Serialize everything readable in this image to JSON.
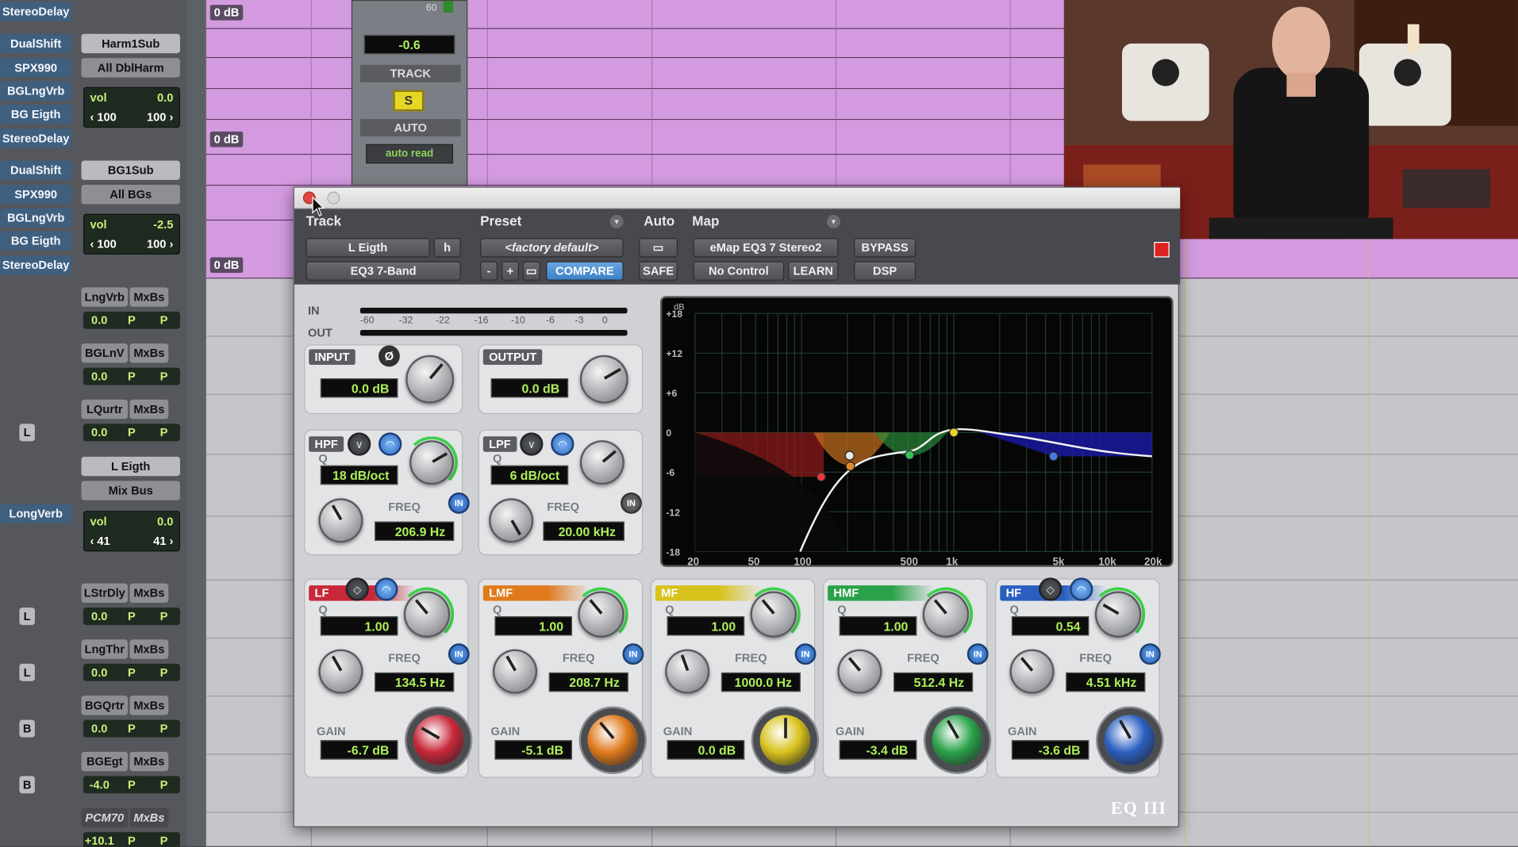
{
  "mixer": {
    "rows_top": [
      {
        "sends": [
          "StereoDelay"
        ]
      },
      {
        "a": "DualShift",
        "b": "SPX990",
        "c": "BGLngVrb",
        "d": "BG Eigth",
        "e": "StereoDelay",
        "insert": "Harm1Sub",
        "group": "All DblHarm",
        "vol_label": "vol",
        "vol_val": "0.0",
        "pan_l": "‹ 100",
        "pan_r": "100 ›"
      },
      {
        "a": "DualShift",
        "b": "SPX990",
        "c": "BGLngVrb",
        "d": "BG Eigth",
        "e": "StereoDelay",
        "insert": "BG1Sub",
        "group": "All BGs",
        "vol_label": "vol",
        "vol_val": "-2.5",
        "pan_l": "‹ 100",
        "pan_r": "100 ›"
      }
    ],
    "bus_rows": [
      {
        "name": "LngVrb",
        "bus": "MxBs",
        "val": "0.0",
        "p1": "P",
        "p2": "P",
        "letter": ""
      },
      {
        "name": "BGLnV",
        "bus": "MxBs",
        "val": "0.0",
        "p1": "P",
        "p2": "P",
        "letter": ""
      },
      {
        "name": "LQurtr",
        "bus": "MxBs",
        "val": "0.0",
        "p1": "P",
        "p2": "P",
        "letter": "L"
      }
    ],
    "leigth": {
      "insert": "L Eigth",
      "output": "Mix Bus",
      "send": "LongVerb",
      "vol_label": "vol",
      "vol_val": "0.0",
      "pan_l": "‹ 41",
      "pan_r": "41 ›"
    },
    "bus_rows2": [
      {
        "name": "LStrDly",
        "bus": "MxBs",
        "val": "0.0",
        "p1": "P",
        "p2": "P",
        "letter": "L"
      },
      {
        "name": "LngThr",
        "bus": "MxBs",
        "val": "0.0",
        "p1": "P",
        "p2": "P",
        "letter": "L"
      },
      {
        "name": "BGQrtr",
        "bus": "MxBs",
        "val": "0.0",
        "p1": "P",
        "p2": "P",
        "letter": "B"
      },
      {
        "name": "BGEgt",
        "bus": "MxBs",
        "val": "-4.0",
        "p1": "P",
        "p2": "P",
        "letter": "B"
      },
      {
        "name": "PCM70",
        "bus": "MxBs",
        "val": "+10.1",
        "p1": "P",
        "p2": "P",
        "letter": ""
      }
    ]
  },
  "timeline": {
    "db_labels": [
      "0 dB",
      "0 dB",
      "0 dB"
    ]
  },
  "track_window": {
    "level_top": "60",
    "value": "-0.6",
    "track_label": "TRACK",
    "solo": "S",
    "auto_label": "AUTO",
    "auto_mode": "auto read"
  },
  "plugin": {
    "header": {
      "track_label": "Track",
      "preset_label": "Preset",
      "auto_label": "Auto",
      "map_label": "Map",
      "track_name": "L Eigth",
      "track_h": "h",
      "preset_name": "<factory default>",
      "insert_name": "EQ3 7-Band",
      "minus": "-",
      "plus": "+",
      "compare": "COMPARE",
      "safe": "SAFE",
      "map_name": "eMap EQ3 7 Stereo2",
      "no_control": "No Control",
      "learn": "LEARN",
      "bypass": "BYPASS",
      "dsp": "DSP"
    },
    "meters": {
      "in": "IN",
      "out": "OUT",
      "scale": [
        "-60",
        "-32",
        "-22",
        "-16",
        "-10",
        "-6",
        "-3",
        "0"
      ]
    },
    "input": {
      "label": "INPUT",
      "phase": "Ø",
      "value": "0.0 dB"
    },
    "output": {
      "label": "OUTPUT",
      "value": "0.0 dB"
    },
    "hpf": {
      "label": "HPF",
      "q_label": "Q",
      "slope": "18 dB/oct",
      "freq_label": "FREQ",
      "freq": "206.9 Hz",
      "in": "IN"
    },
    "lpf": {
      "label": "LPF",
      "q_label": "Q",
      "slope": "6 dB/oct",
      "freq_label": "FREQ",
      "freq": "20.00 kHz",
      "in": "IN"
    },
    "bands": [
      {
        "label": "LF",
        "q_label": "Q",
        "q": "1.00",
        "freq_label": "FREQ",
        "freq": "134.5 Hz",
        "gain_label": "GAIN",
        "gain": "-6.7 dB",
        "in": "IN",
        "color": "#c8283a"
      },
      {
        "label": "LMF",
        "q_label": "Q",
        "q": "1.00",
        "freq_label": "FREQ",
        "freq": "208.7 Hz",
        "gain_label": "GAIN",
        "gain": "-5.1 dB",
        "in": "IN",
        "color": "#e07a1c"
      },
      {
        "label": "MF",
        "q_label": "Q",
        "q": "1.00",
        "freq_label": "FREQ",
        "freq": "1000.0 Hz",
        "gain_label": "GAIN",
        "gain": "0.0 dB",
        "in": "IN",
        "color": "#d8c21c"
      },
      {
        "label": "HMF",
        "q_label": "Q",
        "q": "1.00",
        "freq_label": "FREQ",
        "freq": "512.4 Hz",
        "gain_label": "GAIN",
        "gain": "-3.4 dB",
        "in": "IN",
        "color": "#2aa24a"
      },
      {
        "label": "HF",
        "q_label": "Q",
        "q": "0.54",
        "freq_label": "FREQ",
        "freq": "4.51 kHz",
        "gain_label": "GAIN",
        "gain": "-3.6 dB",
        "in": "IN",
        "color": "#2a5fc0"
      }
    ],
    "graph": {
      "db_label": "dB",
      "y_ticks": [
        "+18",
        "+12",
        "+6",
        "0",
        "-6",
        "-12",
        "-18"
      ],
      "x_ticks": [
        "20",
        "50",
        "100",
        "500",
        "1k",
        "5k",
        "10k",
        "20k"
      ]
    },
    "brand": "EQ III"
  }
}
